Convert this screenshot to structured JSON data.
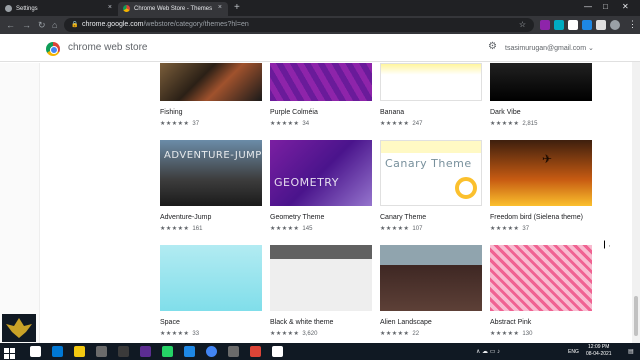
{
  "browser": {
    "tabs": [
      {
        "title": "Settings",
        "close": "×",
        "active": false
      },
      {
        "title": "Chrome Web Store - Themes",
        "close": "×",
        "active": true
      }
    ],
    "new_tab": "+",
    "window_controls": {
      "minimize": "—",
      "maximize": "□",
      "close": "✕"
    },
    "url_host": "chrome.google.com",
    "url_path": "/webstore/category/themes?hl=en",
    "nav": {
      "back": "←",
      "forward": "→",
      "reload": "↻",
      "home": "⌂"
    },
    "lock": "🔒",
    "star": "☆",
    "menu": "⋮",
    "extension_colors": [
      "#8e24aa",
      "#00acc1",
      "#ffffff",
      "#1e88e5",
      "#e0e0e0",
      "#9aa0a6"
    ]
  },
  "store": {
    "title": "chrome web store",
    "settings_icon": "⚙",
    "account": "tsasimurugan@gmail.com ⌄"
  },
  "themes": [
    {
      "name": "Fishing",
      "stars": "★★★★★",
      "count": "37"
    },
    {
      "name": "Purple Colméia",
      "stars": "★★★★★",
      "count": "34"
    },
    {
      "name": "Banana",
      "stars": "★★★★★",
      "count": "247"
    },
    {
      "name": "Dark Vibe",
      "stars": "★★★★★",
      "count": "2,815"
    },
    {
      "name": "Adventure-Jump",
      "stars": "★★★★★",
      "count": "161",
      "thumb_text": "ADVENTURE-JUMP"
    },
    {
      "name": "Geometry Theme",
      "stars": "★★★★★",
      "count": "145",
      "thumb_text": "GEOMETRY"
    },
    {
      "name": "Canary Theme",
      "stars": "★★★★★",
      "count": "107",
      "thumb_text": "Canary Theme"
    },
    {
      "name": "Freedom bird (Sielena theme)",
      "stars": "★★★★★",
      "count": "37"
    },
    {
      "name": "Space",
      "stars": "★★★★★",
      "count": "33"
    },
    {
      "name": "Black & white theme",
      "stars": "★★★★★",
      "count": "3,620"
    },
    {
      "name": "Alien Landscape",
      "stars": "★★★★★",
      "count": "22"
    },
    {
      "name": "Abstract Pink",
      "stars": "★★★★★",
      "count": "130"
    }
  ],
  "taskbar": {
    "time": "12:09 PM",
    "date": "08-04-2021",
    "lang": "ENG",
    "tray": "∧ ☁ ▭ ♪",
    "notifications": "▤",
    "app_colors": [
      "#ffffff",
      "#0078d4",
      "#f2c811",
      "#6b6b6b",
      "#3a3a3a",
      "#5c2d91",
      "#25d366",
      "#1e88e5",
      "#4285f4",
      "#6b6b6b",
      "#db4437",
      "#ffffff"
    ]
  }
}
